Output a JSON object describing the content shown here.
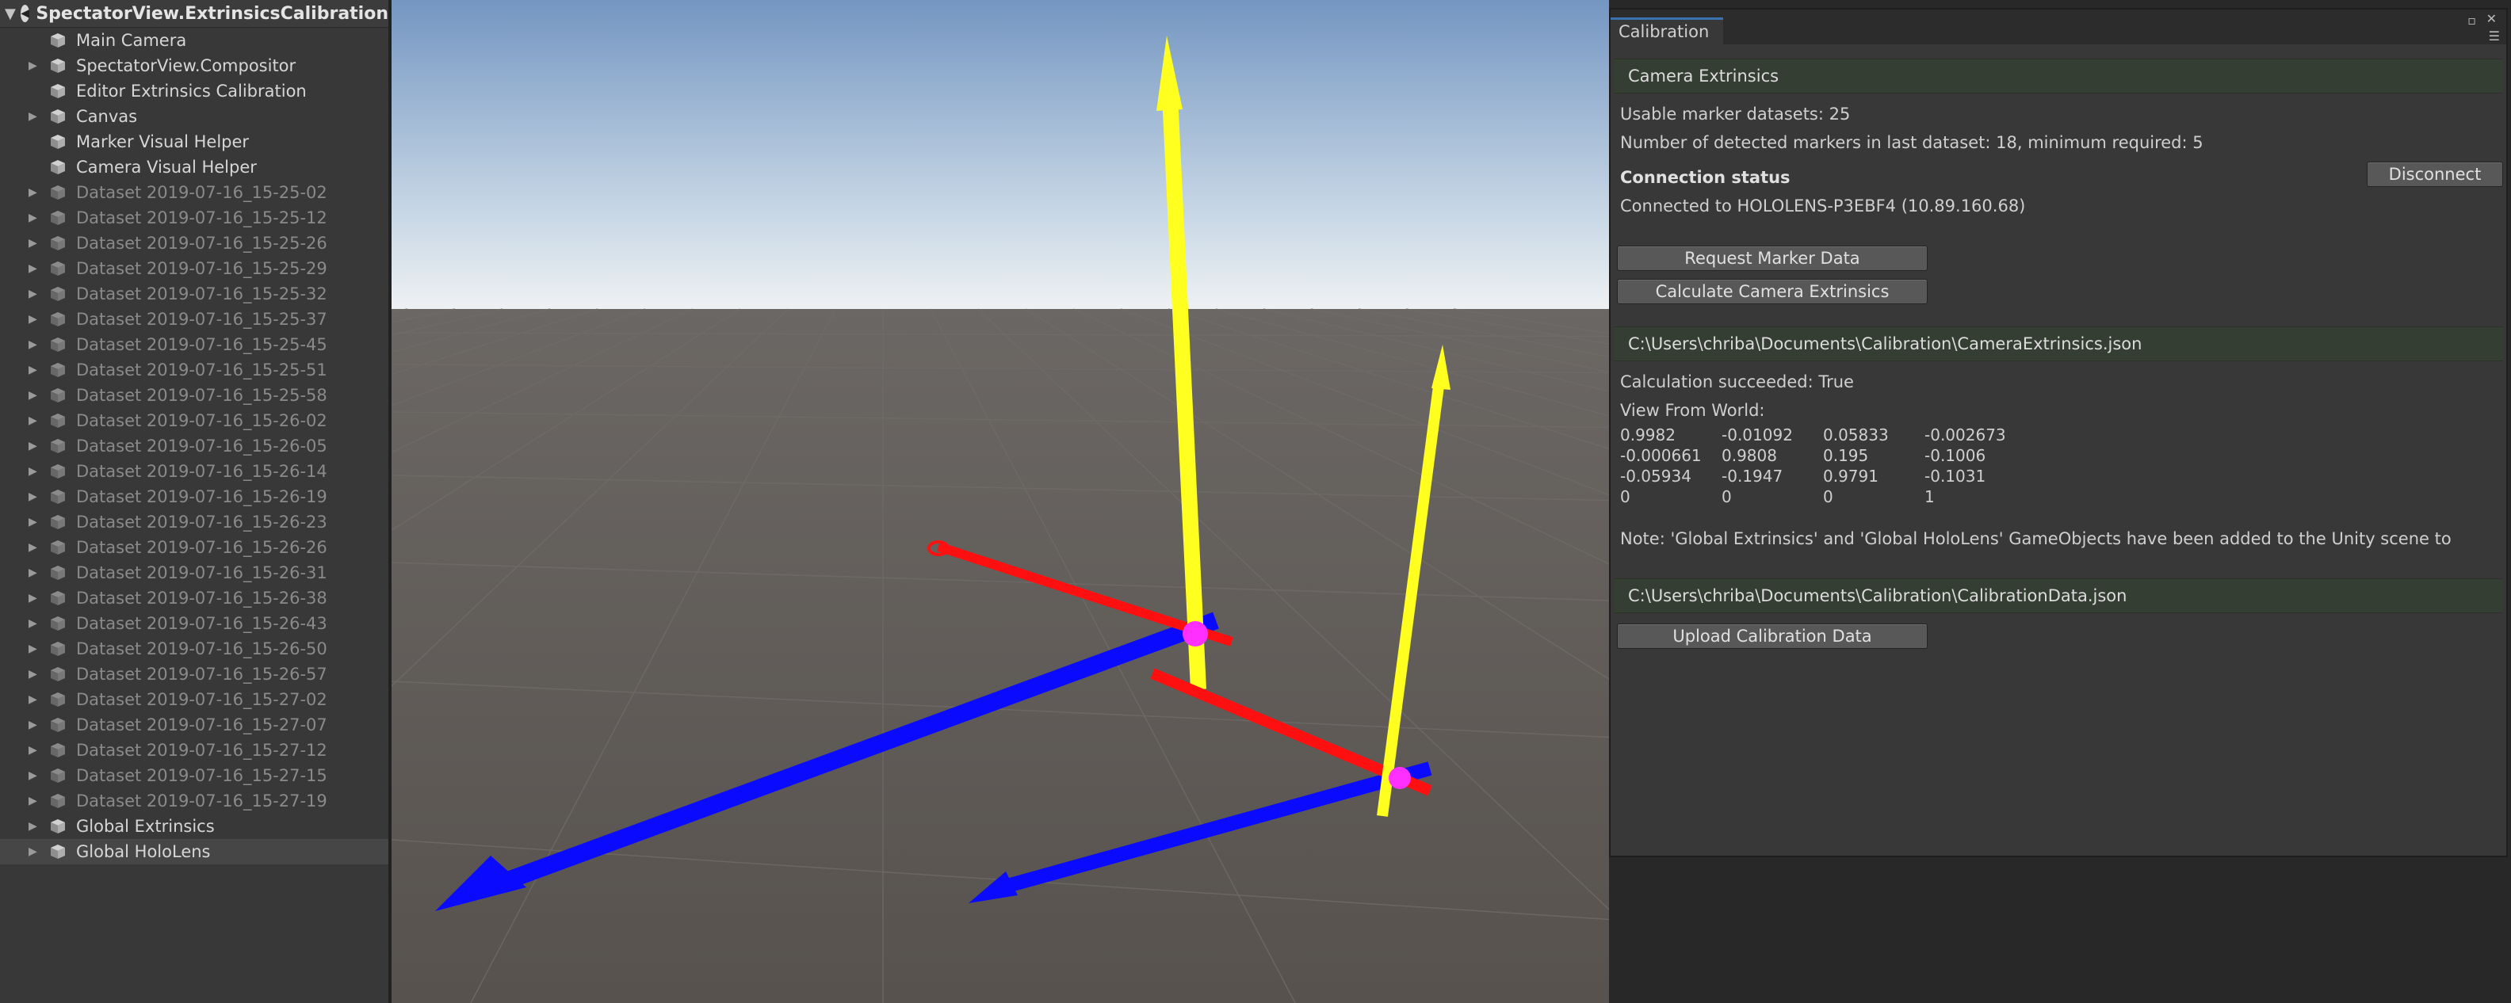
{
  "hierarchy": {
    "scene_title": "SpectatorView.ExtrinsicsCalibration",
    "items": [
      {
        "label": "Main Camera",
        "expandable": false,
        "active": true,
        "selected": false
      },
      {
        "label": "SpectatorView.Compositor",
        "expandable": true,
        "active": true,
        "selected": false
      },
      {
        "label": "Editor Extrinsics Calibration",
        "expandable": false,
        "active": true,
        "selected": false
      },
      {
        "label": "Canvas",
        "expandable": true,
        "active": true,
        "selected": false
      },
      {
        "label": "Marker Visual Helper",
        "expandable": false,
        "active": true,
        "selected": false
      },
      {
        "label": "Camera Visual Helper",
        "expandable": false,
        "active": true,
        "selected": false
      },
      {
        "label": "Dataset 2019-07-16_15-25-02",
        "expandable": true,
        "active": false,
        "selected": false
      },
      {
        "label": "Dataset 2019-07-16_15-25-12",
        "expandable": true,
        "active": false,
        "selected": false
      },
      {
        "label": "Dataset 2019-07-16_15-25-26",
        "expandable": true,
        "active": false,
        "selected": false
      },
      {
        "label": "Dataset 2019-07-16_15-25-29",
        "expandable": true,
        "active": false,
        "selected": false
      },
      {
        "label": "Dataset 2019-07-16_15-25-32",
        "expandable": true,
        "active": false,
        "selected": false
      },
      {
        "label": "Dataset 2019-07-16_15-25-37",
        "expandable": true,
        "active": false,
        "selected": false
      },
      {
        "label": "Dataset 2019-07-16_15-25-45",
        "expandable": true,
        "active": false,
        "selected": false
      },
      {
        "label": "Dataset 2019-07-16_15-25-51",
        "expandable": true,
        "active": false,
        "selected": false
      },
      {
        "label": "Dataset 2019-07-16_15-25-58",
        "expandable": true,
        "active": false,
        "selected": false
      },
      {
        "label": "Dataset 2019-07-16_15-26-02",
        "expandable": true,
        "active": false,
        "selected": false
      },
      {
        "label": "Dataset 2019-07-16_15-26-05",
        "expandable": true,
        "active": false,
        "selected": false
      },
      {
        "label": "Dataset 2019-07-16_15-26-14",
        "expandable": true,
        "active": false,
        "selected": false
      },
      {
        "label": "Dataset 2019-07-16_15-26-19",
        "expandable": true,
        "active": false,
        "selected": false
      },
      {
        "label": "Dataset 2019-07-16_15-26-23",
        "expandable": true,
        "active": false,
        "selected": false
      },
      {
        "label": "Dataset 2019-07-16_15-26-26",
        "expandable": true,
        "active": false,
        "selected": false
      },
      {
        "label": "Dataset 2019-07-16_15-26-31",
        "expandable": true,
        "active": false,
        "selected": false
      },
      {
        "label": "Dataset 2019-07-16_15-26-38",
        "expandable": true,
        "active": false,
        "selected": false
      },
      {
        "label": "Dataset 2019-07-16_15-26-43",
        "expandable": true,
        "active": false,
        "selected": false
      },
      {
        "label": "Dataset 2019-07-16_15-26-50",
        "expandable": true,
        "active": false,
        "selected": false
      },
      {
        "label": "Dataset 2019-07-16_15-26-57",
        "expandable": true,
        "active": false,
        "selected": false
      },
      {
        "label": "Dataset 2019-07-16_15-27-02",
        "expandable": true,
        "active": false,
        "selected": false
      },
      {
        "label": "Dataset 2019-07-16_15-27-07",
        "expandable": true,
        "active": false,
        "selected": false
      },
      {
        "label": "Dataset 2019-07-16_15-27-12",
        "expandable": true,
        "active": false,
        "selected": false
      },
      {
        "label": "Dataset 2019-07-16_15-27-15",
        "expandable": true,
        "active": false,
        "selected": false
      },
      {
        "label": "Dataset 2019-07-16_15-27-19",
        "expandable": true,
        "active": false,
        "selected": false
      },
      {
        "label": "Global Extrinsics",
        "expandable": true,
        "active": true,
        "selected": false
      },
      {
        "label": "Global HoloLens",
        "expandable": true,
        "active": true,
        "selected": true
      }
    ]
  },
  "scene": {
    "axis_colors": {
      "x": "#ff0000",
      "y": "#ffff00",
      "z": "#0000ff",
      "origin": "#ff00ff"
    },
    "sky_top": "#7a9cc6",
    "horizon": "#e8ecf0",
    "ground": "#5b5753"
  },
  "calibration": {
    "tab_title": "Calibration",
    "section_title": "Camera Extrinsics",
    "usable_datasets": "Usable marker datasets: 25",
    "detected_markers": "Number of detected markers in last dataset: 18, minimum required: 5",
    "connection_heading": "Connection status",
    "disconnect_label": "Disconnect",
    "connection_text": "Connected to HOLOLENS-P3EBF4 (10.89.160.68)",
    "request_marker_label": "Request Marker Data",
    "calculate_label": "Calculate Camera Extrinsics",
    "extrinsics_path": "C:\\Users\\chriba\\Documents\\Calibration\\CameraExtrinsics.json",
    "calc_result": "Calculation succeeded: True",
    "view_from_world_label": "View From World:",
    "matrix": [
      [
        "0.9982",
        "-0.01092",
        "0.05833",
        "-0.002673"
      ],
      [
        "-0.000661",
        "0.9808",
        "0.195",
        "-0.1006"
      ],
      [
        "-0.05934",
        "-0.1947",
        "0.9791",
        "-0.1031"
      ],
      [
        "0",
        "0",
        "0",
        "1"
      ]
    ],
    "note": "Note: 'Global Extrinsics' and 'Global HoloLens' GameObjects have been added to the Unity scene to",
    "calibration_data_path": "C:\\Users\\chriba\\Documents\\Calibration\\CalibrationData.json",
    "upload_label": "Upload Calibration Data"
  }
}
